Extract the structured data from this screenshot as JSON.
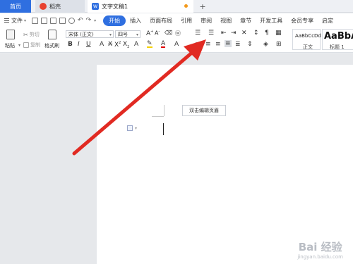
{
  "tabs": {
    "home": "首页",
    "daoke": "稻壳",
    "document": "文字文稿1",
    "new_tab": "+"
  },
  "menu": {
    "file": "文件",
    "items": [
      "开始",
      "插入",
      "页面布局",
      "引用",
      "审阅",
      "视图",
      "章节",
      "开发工具",
      "会员专享",
      "启定"
    ]
  },
  "ribbon": {
    "paste": "粘贴",
    "cut": "剪切",
    "copy": "复制",
    "format_painter": "格式刷",
    "font_family": "宋体 (正文)",
    "font_size": "四号",
    "style_normal_sample": "AaBbCcDd",
    "style_normal_name": "正文",
    "style_heading_sample": "AaBbA",
    "style_heading_name": "标题 1"
  },
  "document": {
    "header_button": "双击编辑页眉"
  },
  "watermark": {
    "logo": "Bai 经验",
    "url": "jingyan.baidu.com"
  },
  "colors": {
    "accent": "#2f6fe0",
    "arrow": "#e12a22"
  }
}
